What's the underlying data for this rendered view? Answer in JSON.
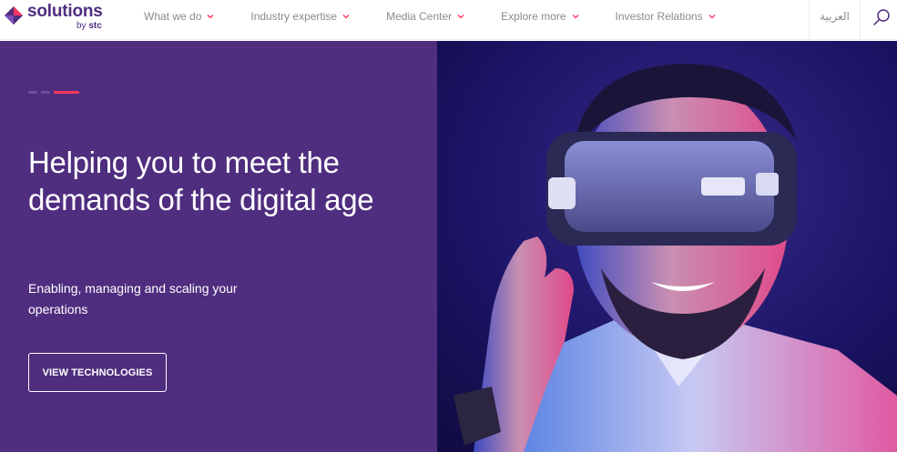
{
  "brand": {
    "name": "solutions",
    "by_prefix": "by",
    "by_brand": "stc",
    "primary_color": "#4f2d7f",
    "accent_color": "#ff375e"
  },
  "nav": {
    "items": [
      {
        "label": "What we do",
        "icon": "chevron-down-icon"
      },
      {
        "label": "Industry expertise",
        "icon": "chevron-down-icon"
      },
      {
        "label": "Media Center",
        "icon": "chevron-down-icon"
      },
      {
        "label": "Explore more",
        "icon": "chevron-down-icon"
      },
      {
        "label": "Investor Relations",
        "icon": "chevron-down-icon"
      }
    ],
    "language_toggle": "العربية",
    "search_icon": "search-icon"
  },
  "hero": {
    "title_line1": "Helping you to meet the",
    "title_line2": "demands of the digital age",
    "subtitle_line1": "Enabling, managing and scaling your",
    "subtitle_line2": "operations",
    "cta_label": "VIEW TECHNOLOGIES",
    "background_color": "#4f2d7f"
  }
}
